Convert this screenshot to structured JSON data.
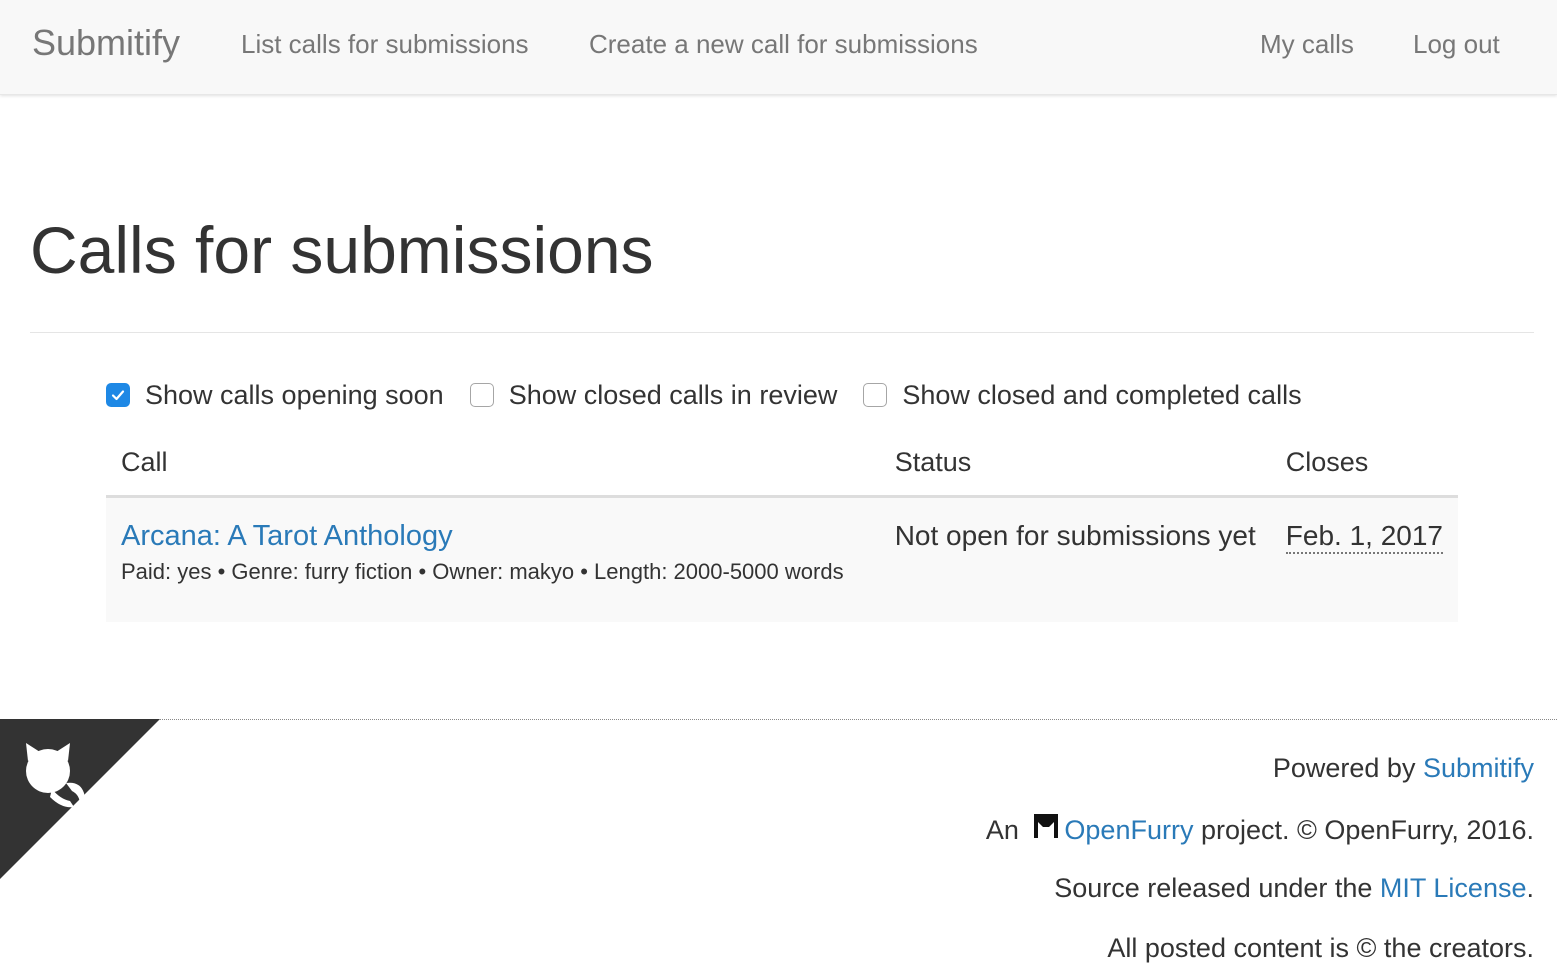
{
  "navbar": {
    "brand": "Submitify",
    "links": [
      {
        "label": "List calls for submissions"
      },
      {
        "label": "Create a new call for submissions"
      },
      {
        "label": "My calls"
      },
      {
        "label": "Log out"
      }
    ]
  },
  "page": {
    "title": "Calls for submissions"
  },
  "filters": [
    {
      "label": "Show calls opening soon",
      "checked": true
    },
    {
      "label": "Show closed calls in review",
      "checked": false
    },
    {
      "label": "Show closed and completed calls",
      "checked": false
    }
  ],
  "table": {
    "headers": [
      "Call",
      "Status",
      "Closes"
    ],
    "rows": [
      {
        "title": "Arcana: A Tarot Anthology",
        "meta": "Paid: yes • Genre: furry fiction • Owner: makyo • Length: 2000-5000 words",
        "status": "Not open for submissions yet",
        "closes": "Feb. 1, 2017"
      }
    ]
  },
  "footer": {
    "powered_prefix": "Powered by ",
    "powered_link": "Submitify",
    "project_prefix": "An ",
    "project_link": "OpenFurry",
    "project_suffix": " project. © OpenFurry, 2016.",
    "source_prefix": "Source released under the ",
    "source_link": "MIT License",
    "source_suffix": ".",
    "content_notice": "All posted content is © the creators."
  },
  "icons": {
    "corner": "github-octocat-icon",
    "openfurry": "openfurry-logo-icon",
    "checkbox_check": "check-icon"
  },
  "colors": {
    "link": "#2a7ab8",
    "checkbox_checked": "#1e88e5",
    "navbar_bg": "#f8f8f8",
    "corner_bg": "#333333"
  }
}
